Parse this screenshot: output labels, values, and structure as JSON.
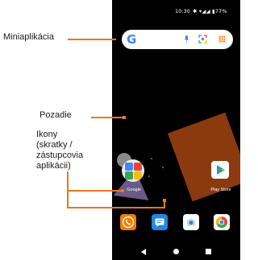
{
  "callouts": {
    "widget": "Miniaplikácia",
    "wallpaper": "Pozadie",
    "icons_lines": [
      "Ikony",
      "(skratky /",
      "zástupcovia",
      "aplikácii)"
    ]
  },
  "status_bar": {
    "time": "10:30",
    "icons_text": "✱ ▾◢◢ ▮77%"
  },
  "search_widget": {
    "logo": "G"
  },
  "home": {
    "folder_label": "Google",
    "playstore_label": "Play Store"
  },
  "colors": {
    "accent": "#e8771e",
    "wallpaper_shape": "#8b3a0f",
    "phone_bg": "#000000"
  }
}
